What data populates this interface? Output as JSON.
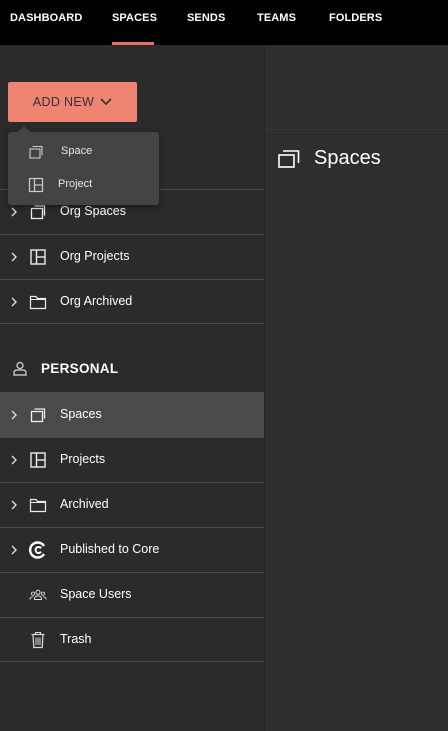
{
  "nav": {
    "items": [
      {
        "label": "DASHBOARD",
        "active": false
      },
      {
        "label": "SPACES",
        "active": true
      },
      {
        "label": "SENDS",
        "active": false
      },
      {
        "label": "TEAMS",
        "active": false
      },
      {
        "label": "FOLDERS",
        "active": false
      }
    ],
    "accent_color": "#e8705f"
  },
  "sidebar": {
    "add_new_label": "ADD NEW",
    "add_new_color": "#ef8472",
    "dropdown": [
      {
        "label": "Space",
        "icon": "space-icon"
      },
      {
        "label": "Project",
        "icon": "project-icon"
      }
    ],
    "org_items": [
      {
        "label": "Org Spaces",
        "icon": "space-icon"
      },
      {
        "label": "Org Projects",
        "icon": "project-icon"
      },
      {
        "label": "Org Archived",
        "icon": "folder-icon"
      }
    ],
    "personal_title": "PERSONAL",
    "personal_items": [
      {
        "label": "Spaces",
        "icon": "space-icon",
        "active": true
      },
      {
        "label": "Projects",
        "icon": "project-icon"
      },
      {
        "label": "Archived",
        "icon": "folder-icon"
      },
      {
        "label": "Published to Core",
        "icon": "core-icon"
      },
      {
        "label": "Space Users",
        "icon": "users-icon"
      },
      {
        "label": "Trash",
        "icon": "trash-icon"
      }
    ]
  },
  "main": {
    "title": "Spaces",
    "title_icon": "space-icon"
  }
}
